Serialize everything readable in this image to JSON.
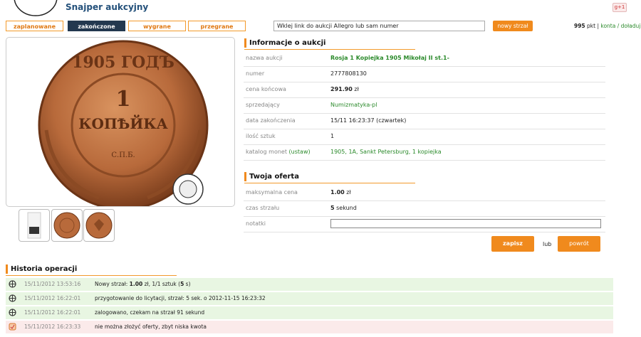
{
  "header": {
    "title": "Snajper aukcyjny",
    "gplus": "g+1"
  },
  "tabs": [
    {
      "label": "zaplanowane",
      "active": false
    },
    {
      "label": "zakończone",
      "active": true
    },
    {
      "label": "wygrane",
      "active": false
    },
    {
      "label": "przegrane",
      "active": false
    }
  ],
  "search": {
    "value": "Wklej link do aukcji Allegro lub sam numer",
    "button": "nowy strzał"
  },
  "account": {
    "points": "995",
    "points_unit": "pkt",
    "links": "konta / doładuj"
  },
  "coin": {
    "year_text": "1905 ГОДЪ",
    "denomination": "1",
    "word": "КОПѢЙКА",
    "mint": "С.П.Б.",
    "accent": "#b06a3a"
  },
  "auction_info": {
    "title": "Informacje o aukcji",
    "rows": [
      {
        "label": "nazwa aukcji",
        "value": "Rosja 1 Kopiejka 1905 Mikołaj II st.1-"
      },
      {
        "label": "numer",
        "value": "2777808130"
      },
      {
        "label": "cena końcowa",
        "value": "291.90",
        "unit": "zł"
      },
      {
        "label": "sprzedający",
        "value": "Numizmatyka-pl"
      },
      {
        "label": "data zakończenia",
        "value": "15/11 16:23:37 (czwartek)"
      },
      {
        "label": "ilość sztuk",
        "value": "1"
      },
      {
        "label": "katalog monet",
        "label_link": "(ustaw)",
        "value": "1905, 1A, Sankt Petersburg, 1 kopiejka"
      }
    ]
  },
  "offer": {
    "title": "Twoja oferta",
    "max_price_label": "maksymalna cena",
    "max_price": "1.00",
    "max_price_unit": "zł",
    "shot_time_label": "czas strzału",
    "shot_time": "5",
    "shot_time_unit": "sekund",
    "notes_label": "notatki",
    "notes_value": "",
    "save_button": "zapisz",
    "or": "lub",
    "back_button": "powrót"
  },
  "history": {
    "title": "Historia operacji",
    "items": [
      {
        "time": "15/11/2012 13:53:16",
        "type": "ok",
        "pre": "Nowy strzał: ",
        "b1": "1.00",
        "mid": " zł, 1/1 sztuk (",
        "b2": "5",
        "post": " s)"
      },
      {
        "time": "15/11/2012 16:22:01",
        "type": "ok",
        "text": "przygotowanie do licytacji, strzał: 5 sek. o 2012-11-15 16:23:32"
      },
      {
        "time": "15/11/2012 16:22:01",
        "type": "ok",
        "text": "zalogowano, czekam na strzał 91 sekund"
      },
      {
        "time": "15/11/2012 16:23:33",
        "type": "err",
        "text": "nie można złożyć oferty, zbyt niska kwota"
      }
    ]
  },
  "colors": {
    "accent": "#f08a1d",
    "green": "#2b8a2b",
    "active_tab": "#23384f",
    "title": "#23507a"
  }
}
